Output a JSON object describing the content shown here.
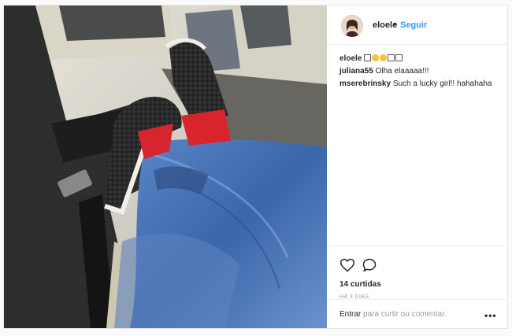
{
  "post": {
    "username": "eloele",
    "dot": "•",
    "follow_label": "Seguir",
    "caption_user": "eloele",
    "comments": [
      {
        "user": "juliana55",
        "text": "Olha elaaaaa!!!"
      },
      {
        "user": "mserebrinsky",
        "text": "Such a lucky girl!! hahahaha"
      }
    ],
    "likes": "14 curtidas",
    "time": "HÁ 3 DIAS",
    "login_link": "Entrar",
    "login_rest": "para curtir ou comentar.",
    "more": "•••"
  },
  "icons": {
    "like": "heart-icon",
    "comment": "comment-bubble-icon",
    "more": "more-options-icon"
  },
  "colors": {
    "link": "#3897f0",
    "secondary_text": "#999999",
    "border": "#efefef",
    "shoe_sock": "#d8242c",
    "jeans": "#4068a8"
  }
}
